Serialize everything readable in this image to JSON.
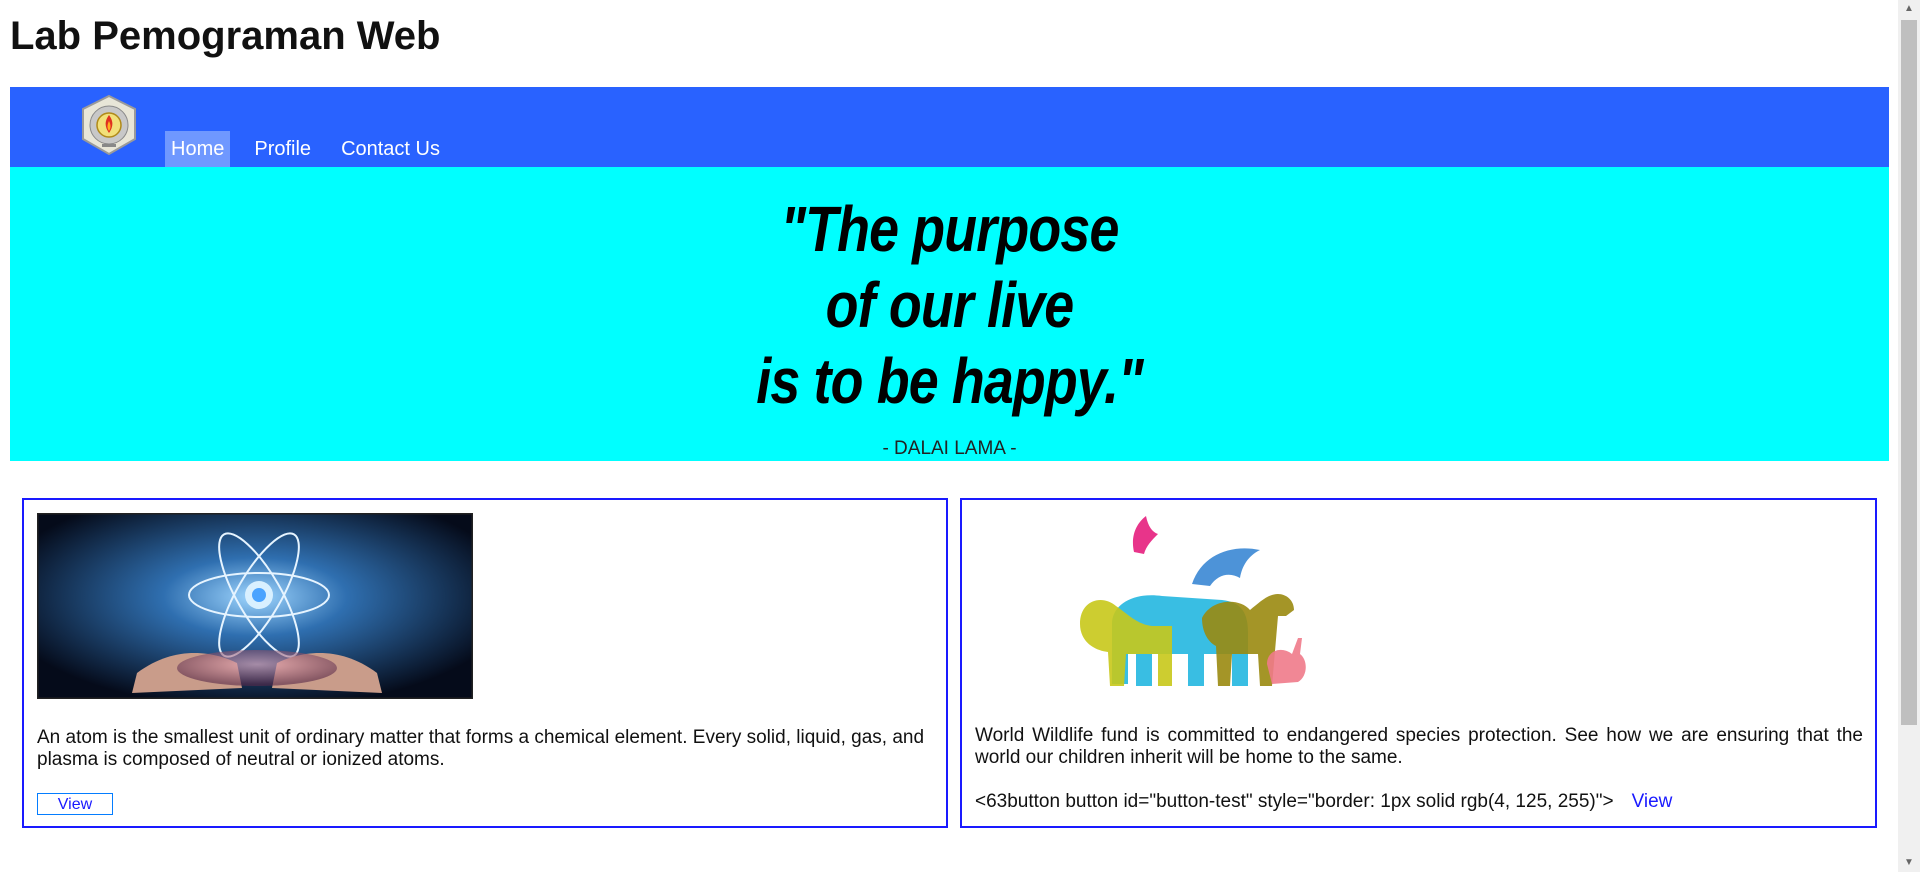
{
  "site_title": "Lab Pemograman Web",
  "nav": {
    "logo_icon": "university-seal-logo",
    "items": [
      {
        "label": "Home",
        "active": true
      },
      {
        "label": "Profile",
        "active": false
      },
      {
        "label": "Contact Us",
        "active": false
      }
    ]
  },
  "hero": {
    "quote_lines": [
      "\"The purpose",
      "of our live",
      "is to be happy.\""
    ],
    "author": "- DALAI LAMA -"
  },
  "cards": [
    {
      "image_icon": "atom-in-hands-image",
      "text": "An atom is the smallest unit of ordinary matter that forms a chemical element. Every solid, liquid, gas, and plasma is composed of neutral or ionized atoms.",
      "button_label": "View"
    },
    {
      "image_icon": "wildlife-animals-image",
      "text": "World Wildlife fund is committed to endangered species protection. See how we are ensuring that the world our children inherit will be home to the same.",
      "raw_code": "<63button button id=\"button-test\" style=\"border: 1px solid rgb(4, 125, 255)\">",
      "link_label": "View"
    }
  ],
  "colors": {
    "navbar": "#2962ff",
    "hero": "#00ffff",
    "card_border": "#1a1aff",
    "button_border": "#047dff"
  }
}
